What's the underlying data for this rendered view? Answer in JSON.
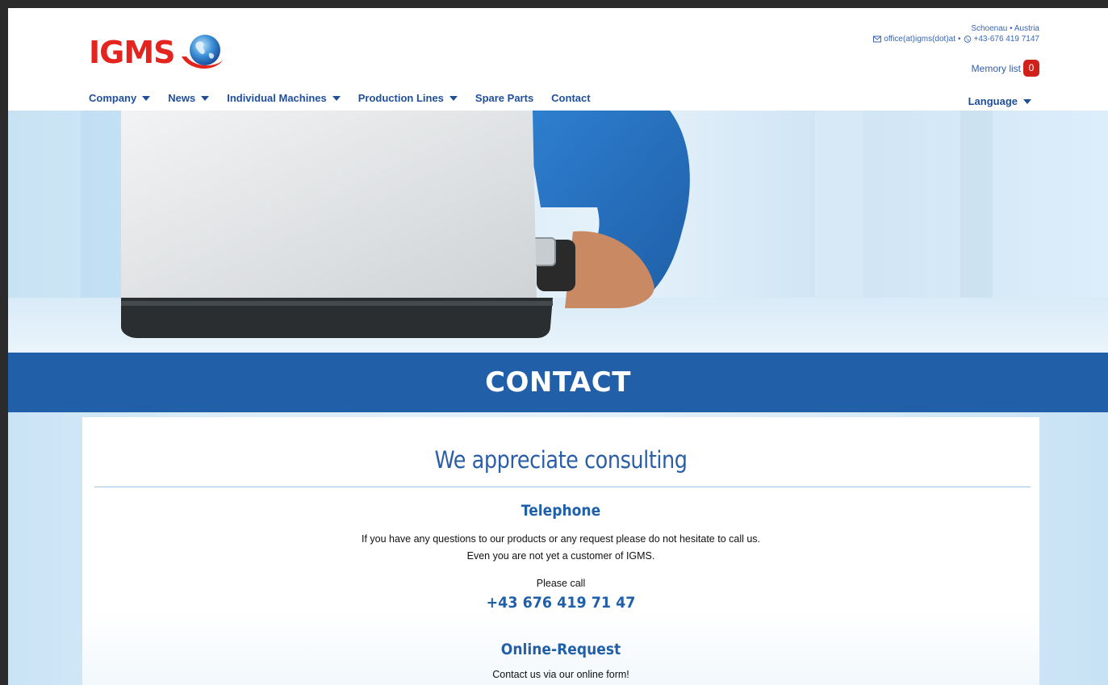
{
  "header": {
    "logo_text": "IGMS",
    "location": "Schoenau • Austria",
    "email": "office(at)igms(dot)at",
    "separator": "•",
    "phone": "+43-676 419 7147",
    "memory_label": "Memory list",
    "memory_count": "0"
  },
  "nav": {
    "items": [
      {
        "label": "Company",
        "dropdown": true
      },
      {
        "label": "News",
        "dropdown": true
      },
      {
        "label": "Individual Machines",
        "dropdown": true
      },
      {
        "label": "Production Lines",
        "dropdown": true
      },
      {
        "label": "Spare Parts",
        "dropdown": false
      },
      {
        "label": "Contact",
        "dropdown": false
      }
    ],
    "language_label": "Language"
  },
  "page": {
    "band_title": "CONTACT",
    "heading": "We appreciate consulting",
    "telephone": {
      "title": "Telephone",
      "line1": "If you have any questions to our products or any request please do not hesitate to call us.",
      "line2": "Even you are not yet a customer of IGMS.",
      "call_label": "Please call",
      "number": "+43 676 419 71 47"
    },
    "online": {
      "title": "Online-Request",
      "text": "Contact us via our online form!"
    }
  },
  "colors": {
    "brand_red": "#e4251f",
    "brand_blue": "#215fa8",
    "nav_blue": "#1f4f9a",
    "badge_red": "#d0201a"
  },
  "icons": {
    "email": "envelope-icon",
    "phone": "phone-icon",
    "logo": "globe-icon",
    "dropdown": "caret-down-icon"
  }
}
